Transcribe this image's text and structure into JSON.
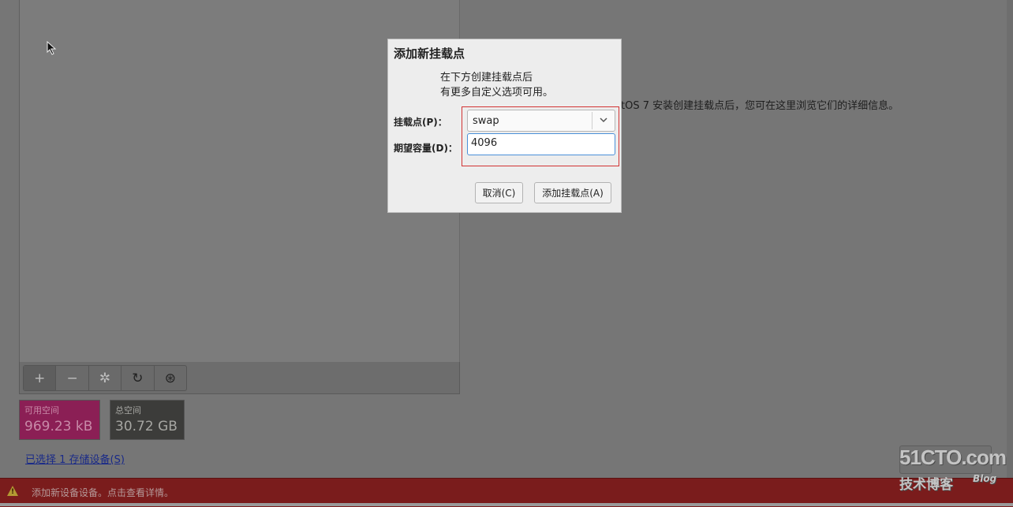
{
  "dialog": {
    "title": "添加新挂载点",
    "desc_line1": "在下方创建挂载点后",
    "desc_line2": "有更多自定义选项可用。",
    "mount_label": "挂载点(P)：",
    "mount_value": "swap",
    "capacity_label": "期望容量(D)：",
    "capacity_value": "4096",
    "cancel_label": "取消(C)",
    "add_label": "添加挂载点(A)"
  },
  "toolbar": {
    "add_glyph": "+",
    "remove_glyph": "−",
    "configure_glyph": "✲",
    "refresh_glyph": "↻",
    "reset_glyph": "⊛"
  },
  "stats": {
    "available_label": "可用空间",
    "available_value": "969.23 kB",
    "total_label": "总空间",
    "total_value": "30.72 GB"
  },
  "storage_link": "已选择 1 存储设备(S)",
  "right_info": "tOS 7 安装创建挂载点后，您可在这里浏览它们的详细信息。",
  "status": {
    "message": "添加新设备设备。点击查看详情。",
    "warning_mark": "!"
  },
  "watermark": {
    "site": "51CTO.com",
    "tagline": "技术博客",
    "blog": "Blog"
  },
  "colors": {
    "available_bg": "#8b1f55",
    "total_bg": "#3c3c3a",
    "statusbar_bg": "#7a1c1c",
    "highlight_border": "#d23333",
    "focus_border": "#4a90d9"
  }
}
